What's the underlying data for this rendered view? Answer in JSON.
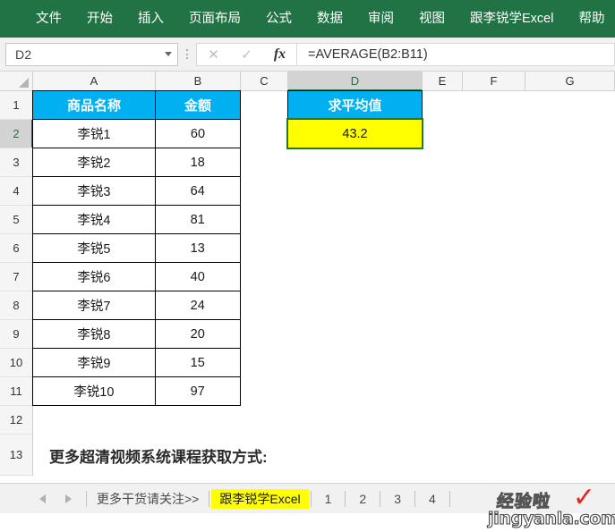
{
  "ribbon": {
    "tabs": [
      {
        "label": "文件"
      },
      {
        "label": "开始"
      },
      {
        "label": "插入"
      },
      {
        "label": "页面布局"
      },
      {
        "label": "公式"
      },
      {
        "label": "数据"
      },
      {
        "label": "审阅"
      },
      {
        "label": "视图"
      },
      {
        "label": "跟李锐学Excel"
      },
      {
        "label": "帮助"
      }
    ],
    "background_color": "#217346"
  },
  "formula_bar": {
    "name_box_value": "D2",
    "cancel_icon": "cancel-x-icon",
    "enter_icon": "confirm-check-icon",
    "function_icon": "fx",
    "formula": "=AVERAGE(B2:B11)"
  },
  "grid": {
    "columns": [
      {
        "label": "A",
        "width": 137,
        "selected": false
      },
      {
        "label": "B",
        "width": 95,
        "selected": false
      },
      {
        "label": "C",
        "width": 53,
        "selected": false
      },
      {
        "label": "D",
        "width": 150,
        "selected": true
      },
      {
        "label": "E",
        "width": 45,
        "selected": false
      },
      {
        "label": "F",
        "width": 70,
        "selected": false
      },
      {
        "label": "G",
        "width": 100,
        "selected": false
      }
    ],
    "row_numbers": [
      "1",
      "2",
      "3",
      "4",
      "5",
      "6",
      "7",
      "8",
      "9",
      "10",
      "11",
      "12",
      "13"
    ],
    "selected_row": "2",
    "header_cyan": "#00b0f0",
    "selected_cell_fill": "#ffff00",
    "selection_border": "#217346",
    "table_headers": {
      "a": "商品名称",
      "b": "金额",
      "d": "求平均值"
    },
    "rows": [
      {
        "n": "2",
        "name": "李锐1",
        "amount": "60"
      },
      {
        "n": "3",
        "name": "李锐2",
        "amount": "18"
      },
      {
        "n": "4",
        "name": "李锐3",
        "amount": "64"
      },
      {
        "n": "5",
        "name": "李锐4",
        "amount": "81"
      },
      {
        "n": "6",
        "name": "李锐5",
        "amount": "13"
      },
      {
        "n": "7",
        "name": "李锐6",
        "amount": "40"
      },
      {
        "n": "8",
        "name": "李锐7",
        "amount": "24"
      },
      {
        "n": "9",
        "name": "李锐8",
        "amount": "20"
      },
      {
        "n": "10",
        "name": "李锐9",
        "amount": "15"
      },
      {
        "n": "11",
        "name": "李锐10",
        "amount": "97"
      }
    ],
    "average_value": "43.2",
    "note_row_13": "更多超清视频系统课程获取方式:"
  },
  "tab_bar": {
    "prev_icon": "prev-sheet-arrow-icon",
    "next_icon": "next-sheet-arrow-icon",
    "sheets": [
      {
        "label": "更多干货请关注>>",
        "active": false
      },
      {
        "label": "跟李锐学Excel",
        "active": true
      },
      {
        "label": "1",
        "active": false
      },
      {
        "label": "2",
        "active": false
      },
      {
        "label": "3",
        "active": false
      },
      {
        "label": "4",
        "active": false
      }
    ]
  },
  "watermark": {
    "chinese": "经验啦",
    "check": "✓",
    "domain": "jingyanla.com"
  }
}
